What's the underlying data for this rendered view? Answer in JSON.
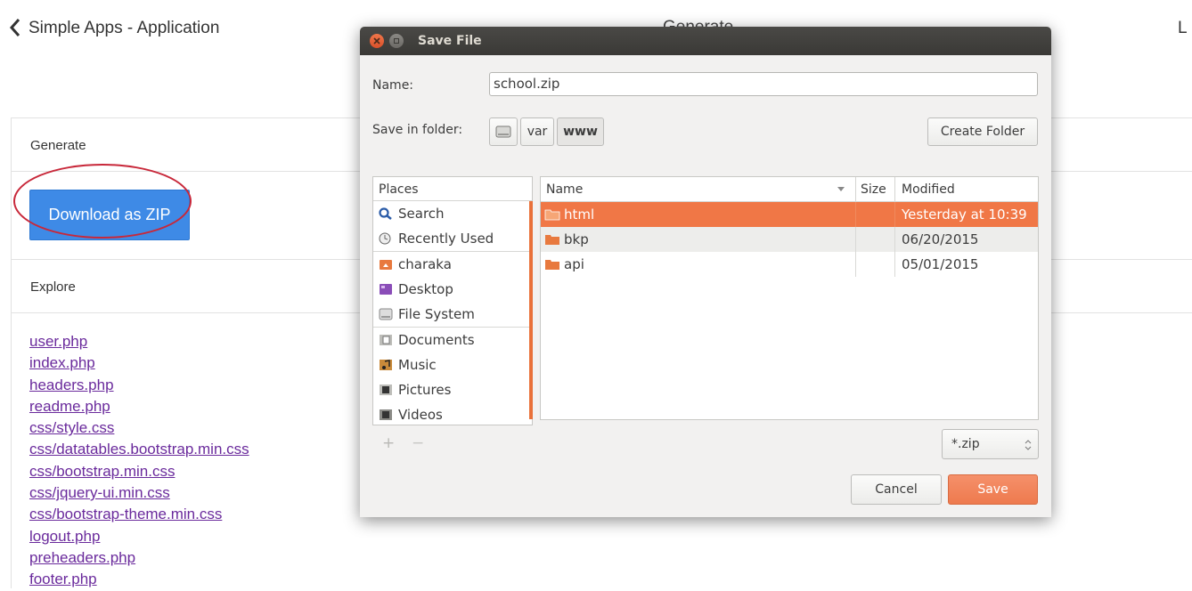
{
  "page": {
    "app_title": "Simple Apps - Application",
    "center_title": "Generate",
    "right_cut_text": "L",
    "generate_heading": "Generate",
    "download_button": "Download as ZIP",
    "explore_heading": "Explore",
    "files": [
      "user.php",
      "index.php",
      "headers.php",
      "readme.php",
      "css/style.css",
      "css/datatables.bootstrap.min.css",
      "css/bootstrap.min.css",
      "css/jquery-ui.min.css",
      "css/bootstrap-theme.min.css",
      "logout.php",
      "preheaders.php",
      "footer.php"
    ]
  },
  "dialog": {
    "title": "Save File",
    "name_label": "Name:",
    "name_value": "school.zip",
    "folder_label": "Save in folder:",
    "path": [
      "var",
      "www"
    ],
    "create_folder": "Create Folder",
    "places_header": "Places",
    "places": [
      {
        "label": "Search",
        "icon": "search-icon"
      },
      {
        "label": "Recently Used",
        "icon": "clock-icon"
      },
      {
        "label": "charaka",
        "icon": "home-folder-icon"
      },
      {
        "label": "Desktop",
        "icon": "desktop-icon"
      },
      {
        "label": "File System",
        "icon": "drive-icon"
      },
      {
        "label": "Documents",
        "icon": "documents-folder-icon"
      },
      {
        "label": "Music",
        "icon": "music-folder-icon"
      },
      {
        "label": "Pictures",
        "icon": "pictures-folder-icon"
      },
      {
        "label": "Videos",
        "icon": "videos-folder-icon"
      }
    ],
    "columns": {
      "name": "Name",
      "size": "Size",
      "modified": "Modified"
    },
    "rows": [
      {
        "name": "html",
        "size": "",
        "modified": "Yesterday at 10:39"
      },
      {
        "name": "bkp",
        "size": "",
        "modified": "06/20/2015"
      },
      {
        "name": "api",
        "size": "",
        "modified": "05/01/2015"
      }
    ],
    "add_label": "+",
    "remove_label": "−",
    "filter": "*.zip",
    "cancel": "Cancel",
    "save": "Save"
  },
  "colors": {
    "accent": "#f07746",
    "link": "#6a2a9c",
    "primary_button": "#3e8ae6",
    "annotation": "#c8283a"
  }
}
